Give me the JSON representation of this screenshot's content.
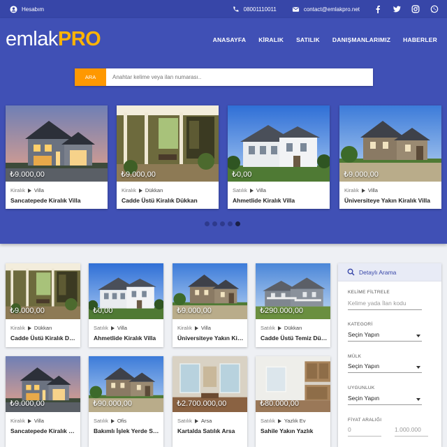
{
  "topbar": {
    "account_label": "Hesabım",
    "phone": "08001110011",
    "email": "contact@emlakpro.net",
    "social": [
      "facebook-icon",
      "twitter-icon",
      "instagram-icon",
      "whatsapp-icon"
    ]
  },
  "brand": {
    "logo_left": "emlak",
    "logo_right": "PRO",
    "accent": "#ffb400"
  },
  "nav": [
    "ANASAYFA",
    "KİRALIK",
    "SATILIK",
    "DANIŞMANLARIMIZ",
    "HABERLER"
  ],
  "search": {
    "button": "ARA",
    "placeholder": "Anahtar kelime veya ilan numarası.."
  },
  "carousel": {
    "cards": [
      {
        "price": "₺9.000,00",
        "type": "Kiralık",
        "category": "Villa",
        "title": "Sancatepede Kiralık Villa",
        "image": "dusk-house"
      },
      {
        "price": "₺9.000,00",
        "type": "Kiralık",
        "category": "Dükkan",
        "title": "Cadde Üstü Kiralık Dükkan",
        "image": "porch"
      },
      {
        "price": "₺0,00",
        "type": "Satılık",
        "category": "Villa",
        "title": "Ahmetlide Kiralık Villa",
        "image": "white-house"
      },
      {
        "price": "₺9.000,00",
        "type": "Kiralık",
        "category": "Villa",
        "title": "Üniversiteye Yakın Kiralık Villa",
        "image": "stone-house"
      }
    ],
    "dots": 5,
    "active_dot": 4
  },
  "listings": [
    {
      "price": "₺9.000,00",
      "type": "Kiralık",
      "category": "Dükkan",
      "title": "Cadde Üstü Kiralık Dükkan",
      "image": "porch"
    },
    {
      "price": "₺0,00",
      "type": "Satılık",
      "category": "Villa",
      "title": "Ahmetlide Kiralık Villa",
      "image": "white-house"
    },
    {
      "price": "₺9.000,00",
      "type": "Kiralık",
      "category": "Villa",
      "title": "Üniversiteye Yakın Kiralık Villa",
      "image": "stone-house"
    },
    {
      "price": "₺290.000,00",
      "type": "Satılık",
      "category": "Dükkan",
      "title": "Cadde Üstü Temiz Dükkan",
      "image": "gray-house"
    },
    {
      "price": "₺9.000,00",
      "type": "Kiralık",
      "category": "Villa",
      "title": "Sancatepede Kiralık Villa",
      "image": "dusk-house"
    },
    {
      "price": "₺90.000,00",
      "type": "Satılık",
      "category": "Ofis",
      "title": "Bakımlı İşlek Yerde Satılık Ofis",
      "image": "stone-house"
    },
    {
      "price": "₺2.700.000,00",
      "type": "Satılık",
      "category": "Arsa",
      "title": "Kartalda Satılık Arsa",
      "image": "interior-room"
    },
    {
      "price": "₺80.000,00",
      "type": "Satılık",
      "category": "Yazlık Ev",
      "title": "Sahile Yakın Yazlık",
      "image": "kitchen"
    }
  ],
  "filter_panel": {
    "title": "Detaylı Arama",
    "keyword_label": "KELİME FİLTRELE",
    "keyword_placeholder": "Kelime yada İlan kodu",
    "category_label": "KATEGORİ",
    "category_value": "Seçin Yapın",
    "property_label": "MÜLK",
    "property_value": "Seçin Yapın",
    "suitability_label": "UYGUNLUK",
    "suitability_value": "Seçin Yapın",
    "price_label": "FİYAT ARALIĞI",
    "price_min": "0",
    "price_max": "1.000.000"
  },
  "colors": {
    "primary": "#4050b5",
    "topbar": "#3746a8",
    "accent": "#ff9800"
  }
}
